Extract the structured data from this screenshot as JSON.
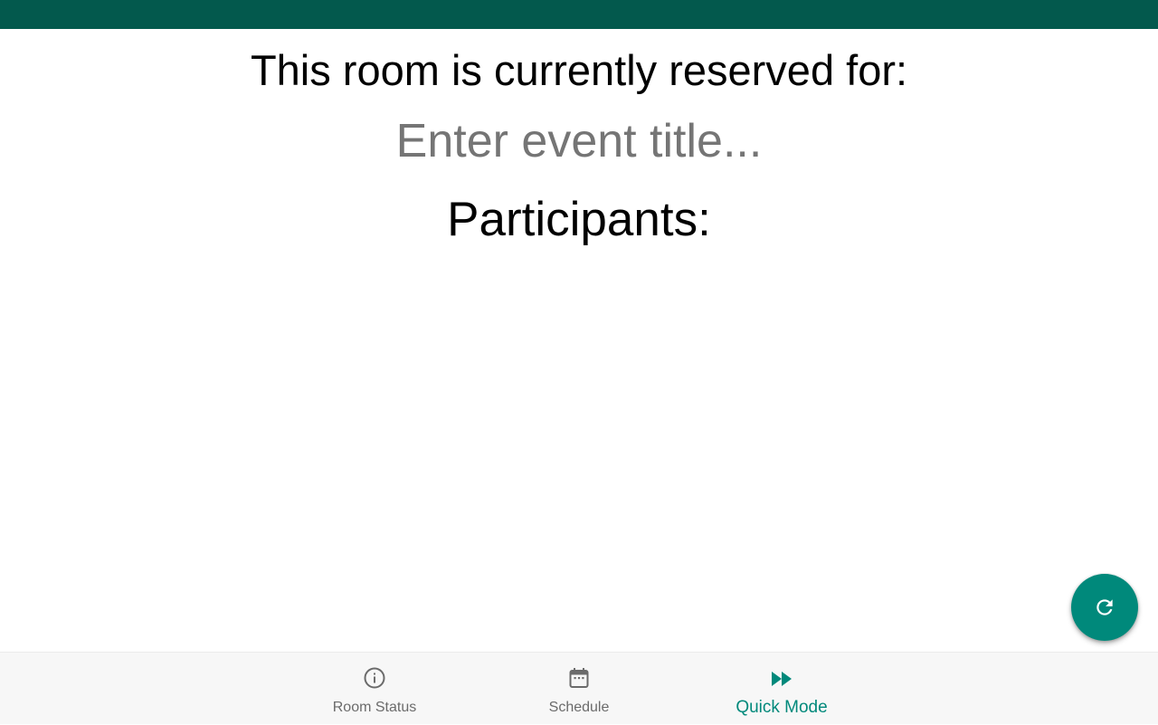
{
  "main": {
    "reserved_heading": "This room is currently reserved for:",
    "event_title_placeholder": "Enter event title...",
    "event_title_value": "",
    "participants_heading": "Participants:"
  },
  "bottom_nav": {
    "items": [
      {
        "label": "Room Status",
        "icon": "info-icon",
        "active": false
      },
      {
        "label": "Schedule",
        "icon": "calendar-icon",
        "active": false
      },
      {
        "label": "Quick Mode",
        "icon": "fast-forward-icon",
        "active": true
      }
    ]
  },
  "fab": {
    "icon": "refresh-icon"
  },
  "colors": {
    "status_bar": "#03594d",
    "accent": "#00897b",
    "nav_background": "#f7f7f7",
    "inactive_label": "#6b6b6b",
    "placeholder": "#757575"
  }
}
